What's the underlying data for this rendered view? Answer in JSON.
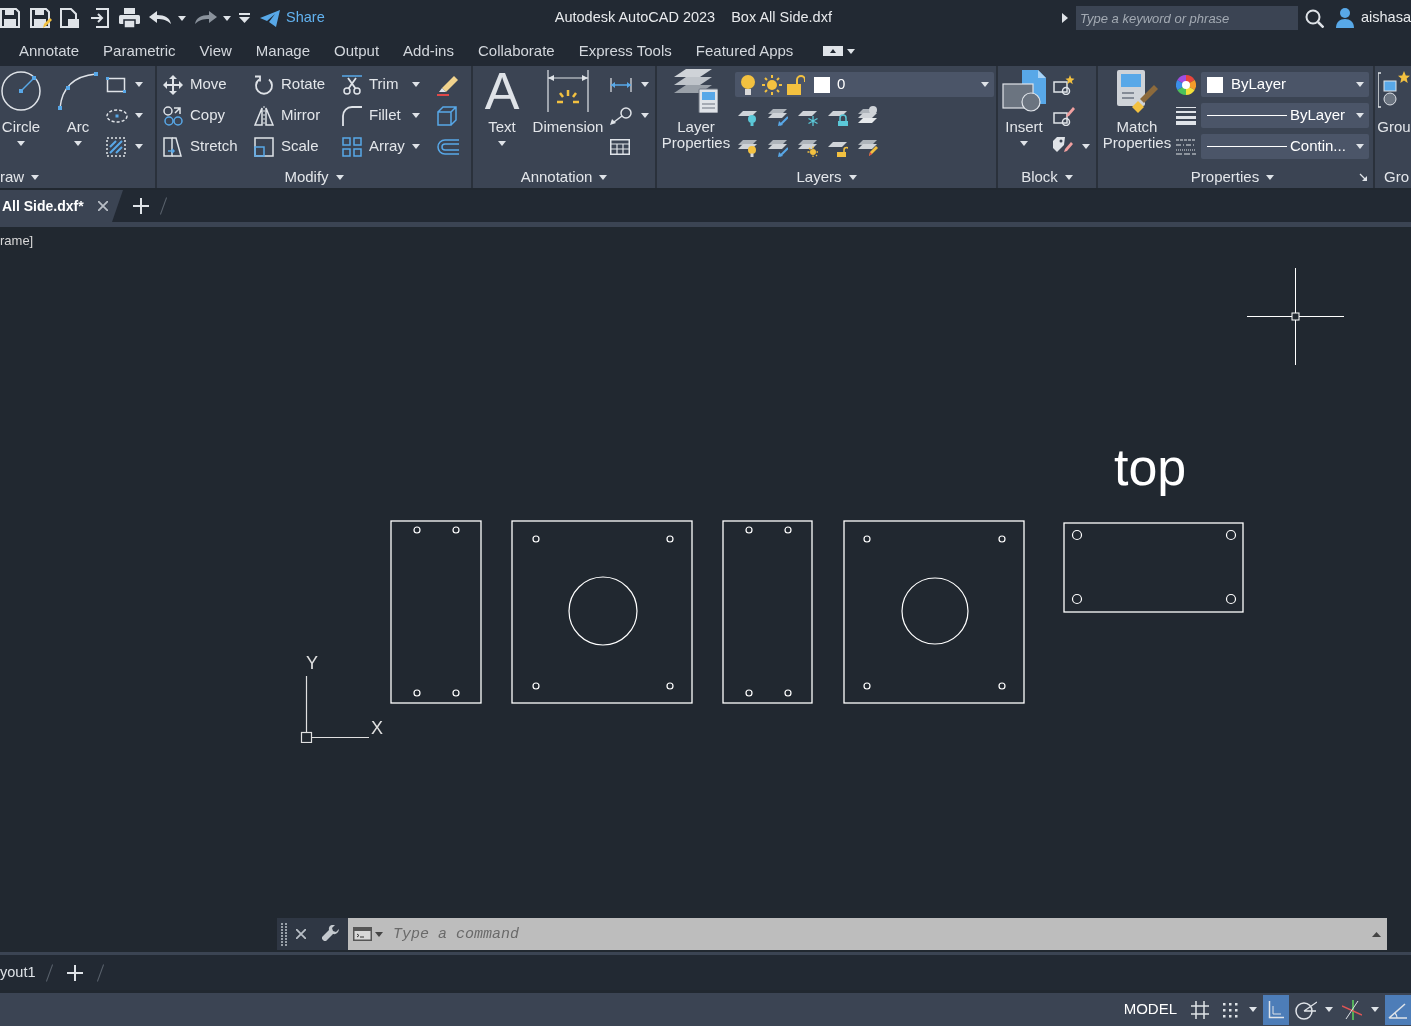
{
  "title_bar": {
    "share": "Share",
    "app_name": "Autodesk AutoCAD 2023",
    "document_name": "Box All Side.dxf",
    "search": {
      "placeholder": "Type a keyword or phrase"
    },
    "user": "aishasa"
  },
  "ribbon_tabs": [
    {
      "label": "Annotate",
      "selected": false
    },
    {
      "label": "Parametric",
      "selected": false
    },
    {
      "label": "View",
      "selected": false
    },
    {
      "label": "Manage",
      "selected": false
    },
    {
      "label": "Output",
      "selected": false
    },
    {
      "label": "Add-ins",
      "selected": false
    },
    {
      "label": "Collaborate",
      "selected": false
    },
    {
      "label": "Express Tools",
      "selected": false
    },
    {
      "label": "Featured Apps",
      "selected": false
    }
  ],
  "ribbon_panels": [
    {
      "kind": "draw",
      "title": "raw",
      "tools": [
        {
          "label": "Circle",
          "dropdown": true
        },
        {
          "label": "Arc",
          "dropdown": true
        }
      ]
    },
    {
      "kind": "modify",
      "title": "Modify",
      "tools": [
        {
          "label": "Move",
          "dropdown": false
        },
        {
          "label": "Rotate",
          "dropdown": false
        },
        {
          "label": "Trim",
          "dropdown": true
        },
        {
          "label": "Copy",
          "dropdown": false
        },
        {
          "label": "Mirror",
          "dropdown": false
        },
        {
          "label": "Fillet",
          "dropdown": true
        },
        {
          "label": "Stretch",
          "dropdown": false
        },
        {
          "label": "Scale",
          "dropdown": false
        },
        {
          "label": "Array",
          "dropdown": true
        }
      ]
    },
    {
      "kind": "annotation",
      "title": "Annotation",
      "tools": [
        {
          "label": "Text",
          "glyph": "A",
          "dropdown": true
        },
        {
          "label": "Dimension",
          "dropdown": false
        }
      ]
    },
    {
      "kind": "layers",
      "title": "Layers",
      "tools": [
        {
          "label": "Layer Properties",
          "dropdown": false
        }
      ],
      "current_layer": "0"
    },
    {
      "kind": "block",
      "title": "Block",
      "tools": [
        {
          "label": "Insert",
          "dropdown": true
        }
      ]
    },
    {
      "kind": "properties",
      "title": "Properties",
      "tools": [
        {
          "label": "Match Properties",
          "dropdown": false
        }
      ],
      "dropdowns": [
        {
          "kind": "color",
          "value": "ByLayer"
        },
        {
          "kind": "lineweight",
          "value": "ByLayer"
        },
        {
          "kind": "linetype",
          "value": "Contin..."
        }
      ]
    },
    {
      "kind": "groups",
      "title": "Gro",
      "tools": [
        {
          "label": "Grou",
          "dropdown": false
        }
      ]
    }
  ],
  "document_tabs": [
    {
      "label": "All Side.dxf*",
      "selected": true
    }
  ],
  "canvas": {
    "viewport_label": "rame]",
    "text_label": "top",
    "ucs": {
      "y": "Y",
      "x": "X"
    }
  },
  "command_line": {
    "placeholder": "Type a command"
  },
  "layout_tabs": [
    {
      "label": "yout1",
      "selected": false
    }
  ],
  "status_bar": {
    "model": "MODEL",
    "toggles": [
      {
        "on": false,
        "dropdown": false
      },
      {
        "on": false,
        "dropdown": true
      },
      {
        "on": true,
        "dropdown": false
      },
      {
        "on": false,
        "dropdown": true
      },
      {
        "on": false,
        "dropdown": true
      },
      {
        "on": true,
        "dropdown": false
      }
    ]
  }
}
